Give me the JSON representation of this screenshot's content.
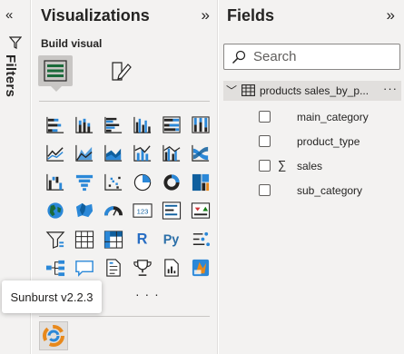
{
  "filters": {
    "label": "Filters"
  },
  "visualizations": {
    "title": "Visualizations",
    "subtitle": "Build visual",
    "more": "· · ·",
    "icons": [
      "stacked-bar-chart-icon",
      "stacked-column-chart-icon",
      "clustered-bar-chart-icon",
      "clustered-column-chart-icon",
      "100-stacked-bar-chart-icon",
      "100-stacked-column-chart-icon",
      "line-chart-icon",
      "area-chart-icon",
      "stacked-area-chart-icon",
      "line-and-column-chart-icon",
      "line-and-clustered-column-chart-icon",
      "ribbon-chart-icon",
      "waterfall-chart-icon",
      "funnel-chart-icon",
      "scatter-chart-icon",
      "pie-chart-icon",
      "donut-chart-icon",
      "treemap-icon",
      "map-icon",
      "filled-map-icon",
      "gauge-icon",
      "card-icon",
      "multi-row-card-icon",
      "kpi-icon",
      "slicer-icon",
      "table-icon",
      "matrix-icon",
      "r-script-visual-icon",
      "python-visual-icon",
      "key-influencers-icon",
      "decomposition-tree-icon",
      "qa-icon",
      "smart-narrative-icon",
      "metrics-icon",
      "paginated-report-icon",
      "power-apps-icon"
    ],
    "r_label": "R",
    "py_label": "Py",
    "card_label": "123",
    "custom_visual": "sunburst-icon"
  },
  "tooltip": {
    "text": "Sunburst v2.2.3"
  },
  "fields": {
    "title": "Fields",
    "search_placeholder": "Search",
    "table_name": "products sales_by_p...",
    "table_more": "···",
    "items": [
      {
        "name": "main_category",
        "sigma": ""
      },
      {
        "name": "product_type",
        "sigma": ""
      },
      {
        "name": "sales",
        "sigma": "∑"
      },
      {
        "name": "sub_category",
        "sigma": ""
      }
    ]
  },
  "colors": {
    "blue": "#2b88d8",
    "dark_blue": "#0f5f9e",
    "accent_teal": "#118dff",
    "pane_bg": "#f3f2f1"
  }
}
